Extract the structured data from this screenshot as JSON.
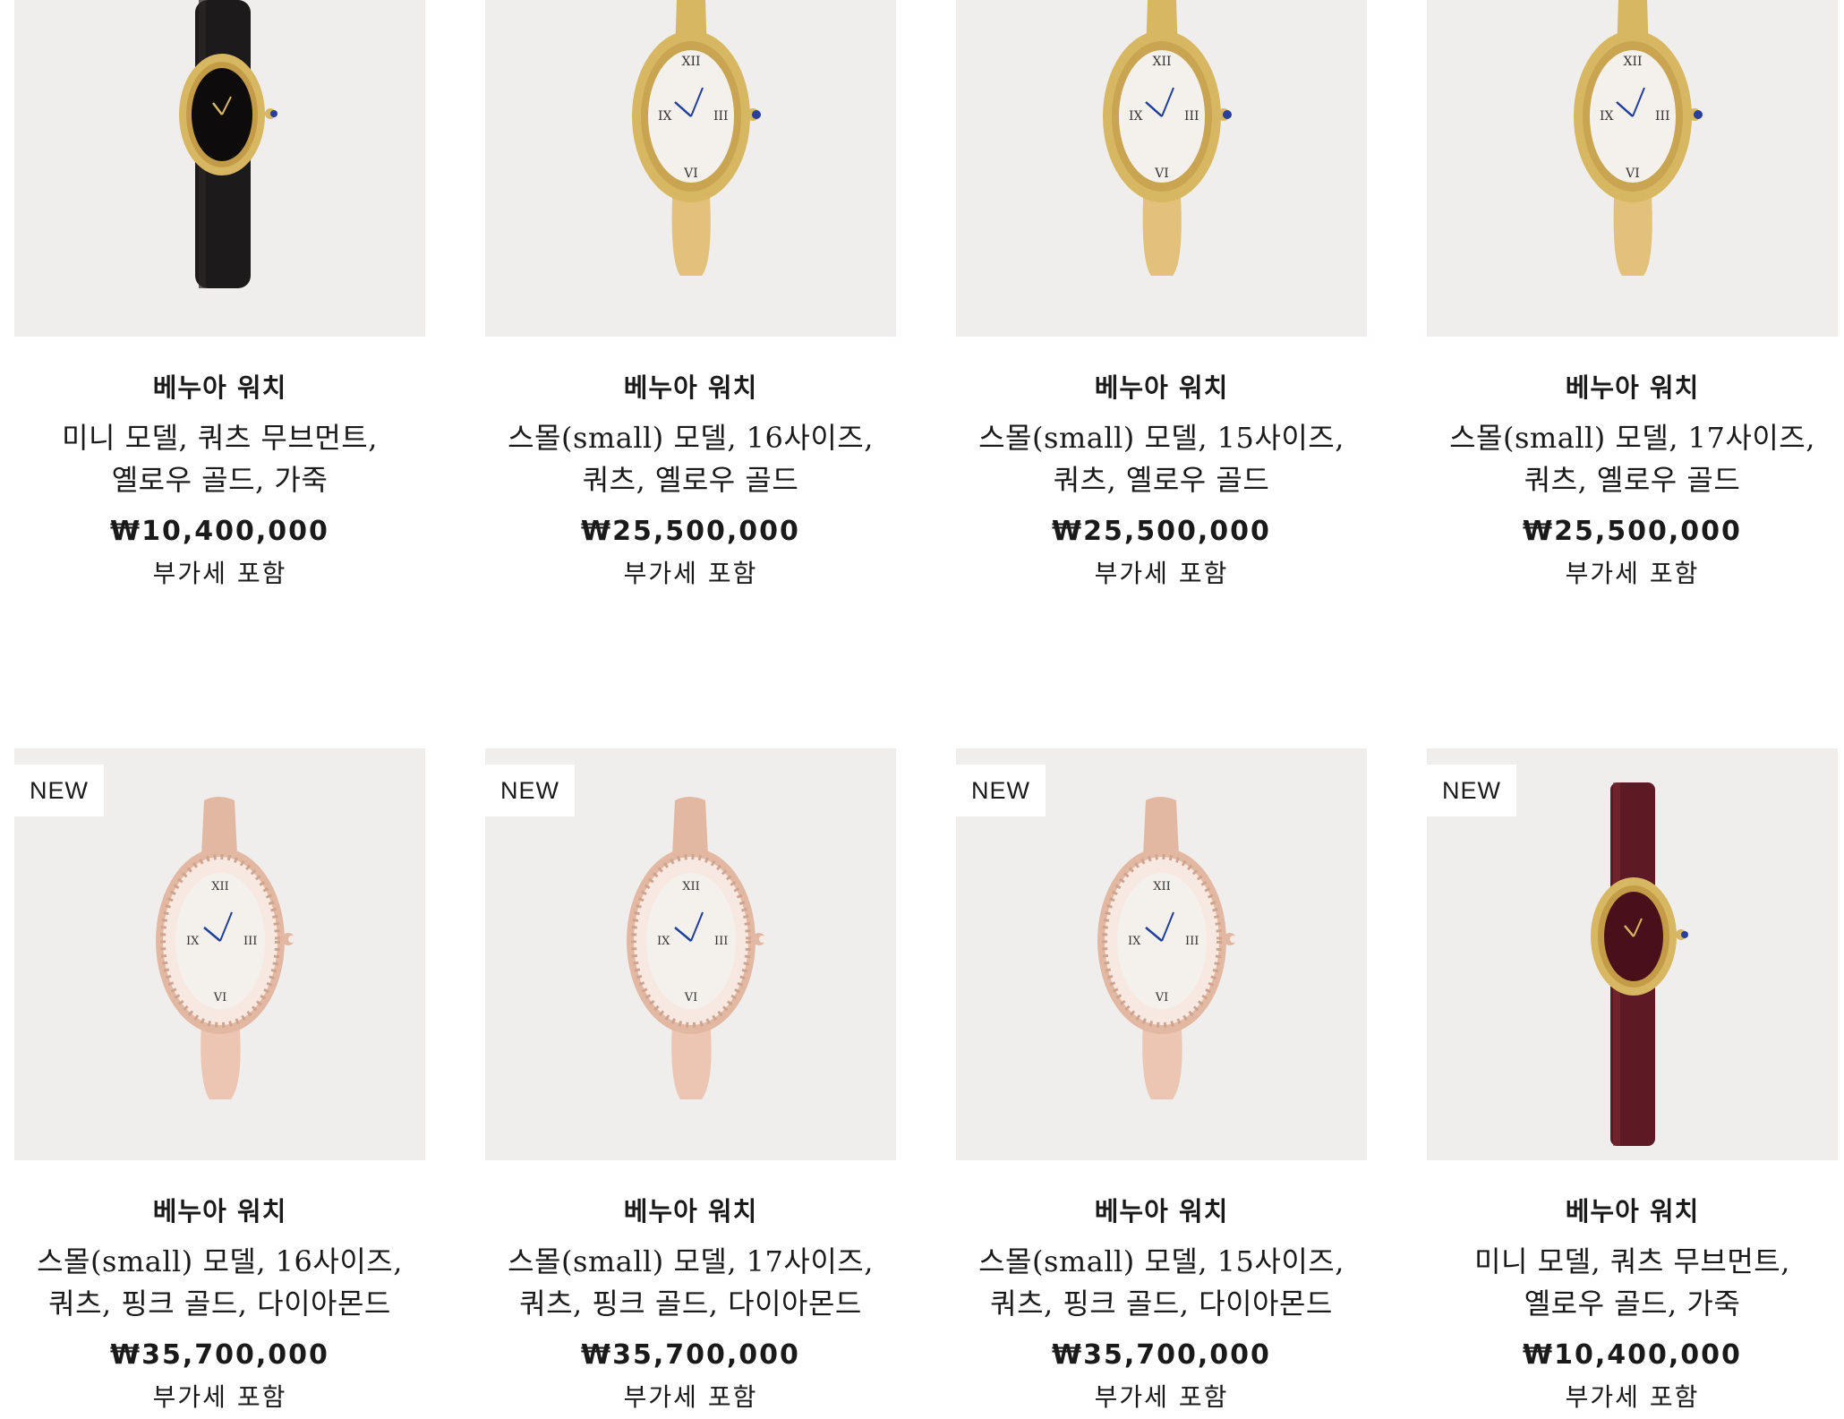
{
  "products": [
    {
      "badge": "",
      "image": "watch-black-leather-yellow-gold",
      "name": "베누아 워치",
      "desc": "미니 모델, 쿼츠 무브먼트, 옐로우 골드, 가죽",
      "price": "₩10,400,000",
      "vat": "부가세 포함"
    },
    {
      "badge": "",
      "image": "watch-yellow-gold-bangle",
      "name": "베누아 워치",
      "desc": "스몰(small) 모델, 16사이즈, 쿼츠, 옐로우 골드",
      "price": "₩25,500,000",
      "vat": "부가세 포함"
    },
    {
      "badge": "",
      "image": "watch-yellow-gold-bangle",
      "name": "베누아 워치",
      "desc": "스몰(small) 모델, 15사이즈, 쿼츠, 옐로우 골드",
      "price": "₩25,500,000",
      "vat": "부가세 포함"
    },
    {
      "badge": "",
      "image": "watch-yellow-gold-bangle",
      "name": "베누아 워치",
      "desc": "스몰(small) 모델, 17사이즈, 쿼츠, 옐로우 골드",
      "price": "₩25,500,000",
      "vat": "부가세 포함"
    },
    {
      "badge": "NEW",
      "image": "watch-pink-gold-diamond-bangle",
      "name": "베누아 워치",
      "desc": "스몰(small) 모델, 16사이즈, 쿼츠, 핑크 골드, 다이아몬드",
      "price": "₩35,700,000",
      "vat": "부가세 포함"
    },
    {
      "badge": "NEW",
      "image": "watch-pink-gold-diamond-bangle",
      "name": "베누아 워치",
      "desc": "스몰(small) 모델, 17사이즈, 쿼츠, 핑크 골드, 다이아몬드",
      "price": "₩35,700,000",
      "vat": "부가세 포함"
    },
    {
      "badge": "NEW",
      "image": "watch-pink-gold-diamond-bangle",
      "name": "베누아 워치",
      "desc": "스몰(small) 모델, 15사이즈, 쿼츠, 핑크 골드, 다이아몬드",
      "price": "₩35,700,000",
      "vat": "부가세 포함"
    },
    {
      "badge": "NEW",
      "image": "watch-burgundy-leather-yellow-gold",
      "name": "베누아 워치",
      "desc": "미니 모델, 쿼츠 무브먼트, 옐로우 골드, 가죽",
      "price": "₩10,400,000",
      "vat": "부가세 포함"
    }
  ],
  "colors": {
    "image_bg": "#efeeec",
    "badge_bg": "#ffffff",
    "text": "#1a1a1a",
    "yellow_gold": "#d8b763",
    "pink_gold": "#e3b8a2",
    "black_strap": "#1c1a1a",
    "burgundy_strap": "#5e1a24",
    "crown_stone": "#2a3f9a"
  }
}
